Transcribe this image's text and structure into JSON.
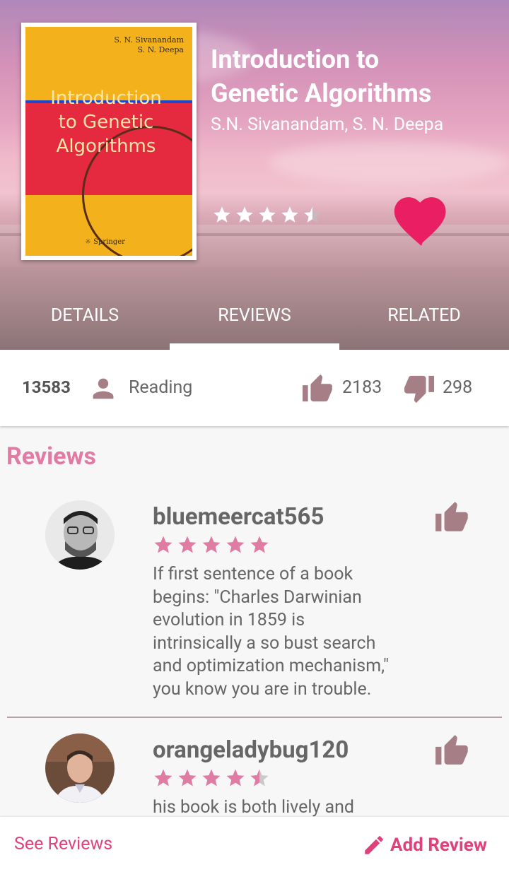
{
  "book": {
    "title_line1": "Introduction to",
    "title_line2": "Genetic Algorithms",
    "authors": "S.N. Sivanandam, S. N. Deepa",
    "rating": 4.5,
    "favorite": true,
    "cover": {
      "author1": "S. N. Sivanandam",
      "author2": "S. N. Deepa",
      "title_line1": "Introduction",
      "title_line2": "to Genetic",
      "title_line3": "Algorithms",
      "publisher": "Springer"
    }
  },
  "tabs": [
    {
      "label": "DETAILS"
    },
    {
      "label": "REVIEWS"
    },
    {
      "label": "RELATED"
    }
  ],
  "active_tab": "REVIEWS",
  "stats": {
    "readers": "13583",
    "reading_label": "Reading",
    "likes": "2183",
    "dislikes": "298"
  },
  "reviews_section": {
    "title": "Reviews",
    "items": [
      {
        "username": "bluemeercat565",
        "rating": 5,
        "text_lines": [
          "If first sentence of a book",
          "begins: \"Charles Darwinian",
          "evolution in 1859 is",
          "intrinsically a so bust search",
          "and optimization mechanism,\"",
          "you know you are in trouble."
        ]
      },
      {
        "username": "orangeladybug120",
        "rating": 4.5,
        "text_lines": [
          "his book is both lively and"
        ]
      }
    ]
  },
  "footer": {
    "see_reviews": "See Reviews",
    "add_review": "Add Review"
  },
  "colors": {
    "accent": "#e0417b",
    "section_title": "#e07ba4",
    "star_pink": "#e07ba4",
    "icon_muted": "#a57f85",
    "heart": "#e91e63"
  }
}
